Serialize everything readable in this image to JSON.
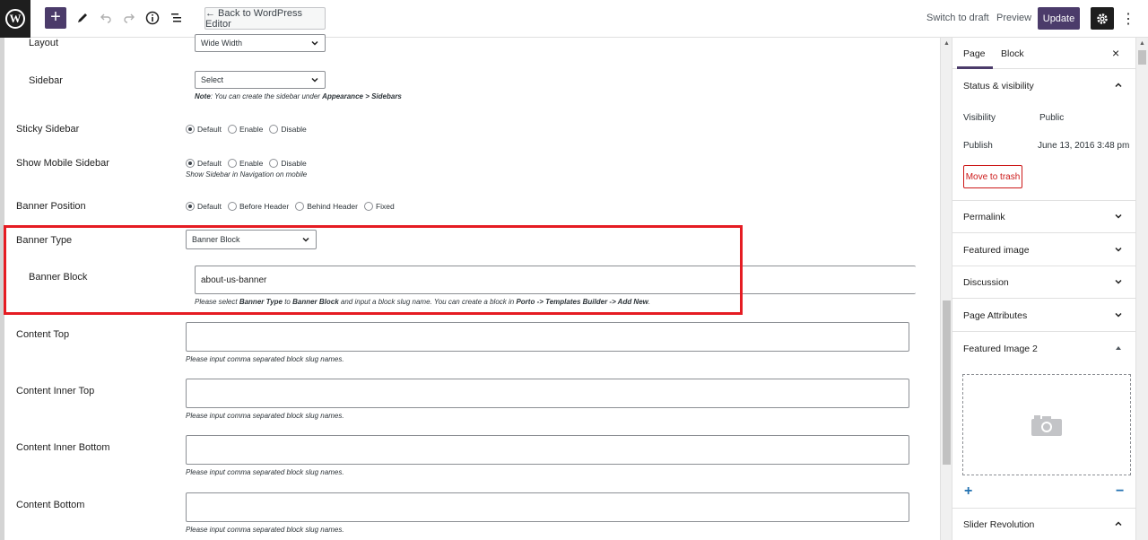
{
  "toolbar": {
    "wp_logo": "W",
    "back_label": "← Back to WordPress Editor",
    "switch_draft": "Switch to draft",
    "preview": "Preview",
    "update": "Update"
  },
  "form": {
    "layout_label": "Layout",
    "layout_value": "Wide Width",
    "sidebar_label": "Sidebar",
    "sidebar_value": "Select",
    "sidebar_note_prefix": "Note",
    "sidebar_note_text": ": You can create the sidebar under ",
    "sidebar_note_path": "Appearance > Sidebars",
    "sticky_label": "Sticky Sidebar",
    "sticky_options": [
      "Default",
      "Enable",
      "Disable"
    ],
    "mobile_label": "Show Mobile Sidebar",
    "mobile_options": [
      "Default",
      "Enable",
      "Disable"
    ],
    "mobile_note": "Show Sidebar in Navigation on mobile",
    "banner_pos_label": "Banner Position",
    "banner_pos_options": [
      "Default",
      "Before Header",
      "Behind Header",
      "Fixed"
    ],
    "banner_type_label": "Banner Type",
    "banner_type_value": "Banner Block",
    "banner_block_label": "Banner Block",
    "banner_block_value": "about-us-banner",
    "banner_note_1": "Please select ",
    "banner_note_2": "Banner Type",
    "banner_note_3": " to ",
    "banner_note_4": "Banner Block",
    "banner_note_5": " and input a block slug name. You can create a block in ",
    "banner_note_6": "Porto -> Templates Builder -> Add New",
    "banner_note_7": ".",
    "content_top_label": "Content Top",
    "content_inner_top_label": "Content Inner Top",
    "content_inner_bottom_label": "Content Inner Bottom",
    "content_bottom_label": "Content Bottom",
    "slug_note": "Please input comma separated block slug names."
  },
  "sidebar": {
    "tab_page": "Page",
    "tab_block": "Block",
    "close": "×",
    "status_title": "Status & visibility",
    "visibility_label": "Visibility",
    "visibility_value": "Public",
    "publish_label": "Publish",
    "publish_value": "June 13, 2016 3:48 pm",
    "move_trash": "Move to trash",
    "permalink": "Permalink",
    "featured_image": "Featured image",
    "discussion": "Discussion",
    "page_attributes": "Page Attributes",
    "featured_image_2": "Featured Image 2",
    "slider_revolution": "Slider Revolution",
    "plus": "+",
    "minus": "−"
  },
  "colors": {
    "accent": "#4b3b6a",
    "highlight": "#e51c23",
    "trash": "#cc1818"
  }
}
